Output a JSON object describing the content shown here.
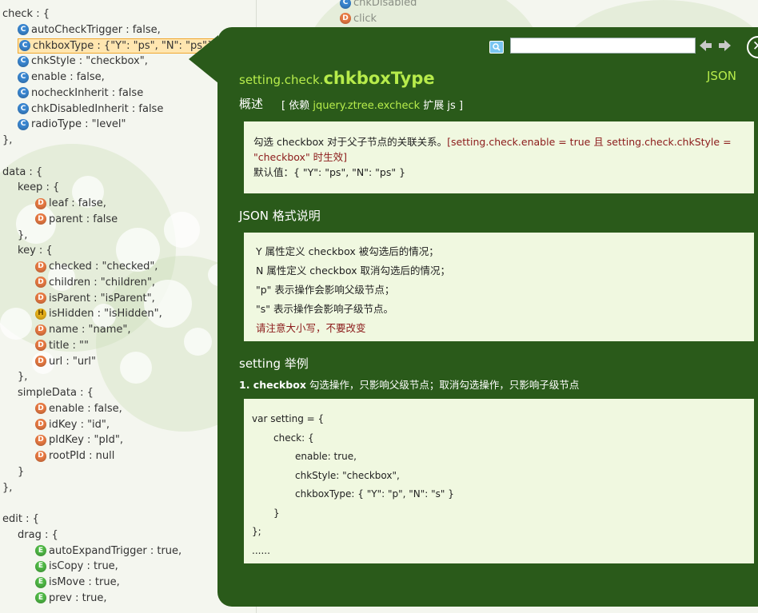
{
  "tree": {
    "lines": [
      {
        "id": "check-open",
        "indent": 0,
        "icon": "",
        "text": "check : {"
      },
      {
        "id": "check-autoCheckTrigger",
        "indent": 1,
        "icon": "c",
        "text": "autoCheckTrigger : false,"
      },
      {
        "id": "check-chkboxType",
        "indent": 1,
        "icon": "c",
        "text": "chkboxType : {\"Y\": \"ps\", \"N\": \"ps\"},",
        "current": true
      },
      {
        "id": "check-chkStyle",
        "indent": 1,
        "icon": "c",
        "text": "chkStyle : \"checkbox\","
      },
      {
        "id": "check-enable",
        "indent": 1,
        "icon": "c",
        "text": "enable : false,"
      },
      {
        "id": "check-nocheckInherit",
        "indent": 1,
        "icon": "c",
        "text": "nocheckInherit : false"
      },
      {
        "id": "check-chkDisabledInherit",
        "indent": 1,
        "icon": "c",
        "text": "chkDisabledInherit : false"
      },
      {
        "id": "check-radioType",
        "indent": 1,
        "icon": "c",
        "text": "radioType : \"level\""
      },
      {
        "id": "check-close",
        "indent": 0,
        "icon": "",
        "text": "},"
      },
      {
        "id": "blank1",
        "indent": 0,
        "icon": "",
        "text": ""
      },
      {
        "id": "data-open",
        "indent": 0,
        "icon": "",
        "text": "data : {"
      },
      {
        "id": "keep-open",
        "indent": 1,
        "icon": "",
        "text": "keep : {"
      },
      {
        "id": "keep-leaf",
        "indent": 2,
        "icon": "d",
        "text": "leaf : false,"
      },
      {
        "id": "keep-parent",
        "indent": 2,
        "icon": "d",
        "text": "parent : false"
      },
      {
        "id": "keep-close",
        "indent": 1,
        "icon": "",
        "text": "},"
      },
      {
        "id": "key-open",
        "indent": 1,
        "icon": "",
        "text": "key : {"
      },
      {
        "id": "key-checked",
        "indent": 2,
        "icon": "d",
        "text": "checked : \"checked\","
      },
      {
        "id": "key-children",
        "indent": 2,
        "icon": "d",
        "text": "children : \"children\","
      },
      {
        "id": "key-isParent",
        "indent": 2,
        "icon": "d",
        "text": "isParent : \"isParent\","
      },
      {
        "id": "key-isHidden",
        "indent": 2,
        "icon": "h",
        "text": "isHidden : \"isHidden\","
      },
      {
        "id": "key-name",
        "indent": 2,
        "icon": "d",
        "text": "name : \"name\","
      },
      {
        "id": "key-title",
        "indent": 2,
        "icon": "d",
        "text": "title : \"\""
      },
      {
        "id": "key-url",
        "indent": 2,
        "icon": "d",
        "text": "url : \"url\""
      },
      {
        "id": "key-close",
        "indent": 1,
        "icon": "",
        "text": "},"
      },
      {
        "id": "simpleData-open",
        "indent": 1,
        "icon": "",
        "text": "simpleData : {"
      },
      {
        "id": "sd-enable",
        "indent": 2,
        "icon": "d",
        "text": "enable : false,"
      },
      {
        "id": "sd-idKey",
        "indent": 2,
        "icon": "d",
        "text": "idKey : \"id\","
      },
      {
        "id": "sd-pIdKey",
        "indent": 2,
        "icon": "d",
        "text": "pIdKey : \"pId\","
      },
      {
        "id": "sd-rootPId",
        "indent": 2,
        "icon": "d",
        "text": "rootPId : null"
      },
      {
        "id": "simpleData-close",
        "indent": 1,
        "icon": "",
        "text": "}"
      },
      {
        "id": "data-close",
        "indent": 0,
        "icon": "",
        "text": "},"
      },
      {
        "id": "blank2",
        "indent": 0,
        "icon": "",
        "text": ""
      },
      {
        "id": "edit-open",
        "indent": 0,
        "icon": "",
        "text": "edit : {"
      },
      {
        "id": "drag-open",
        "indent": 1,
        "icon": "",
        "text": "drag : {"
      },
      {
        "id": "drag-autoExpandTrigger",
        "indent": 2,
        "icon": "e",
        "text": "autoExpandTrigger : true,"
      },
      {
        "id": "drag-isCopy",
        "indent": 2,
        "icon": "e",
        "text": "isCopy : true,"
      },
      {
        "id": "drag-isMove",
        "indent": 2,
        "icon": "e",
        "text": "isMove : true,"
      },
      {
        "id": "drag-prev",
        "indent": 2,
        "icon": "e",
        "text": "prev : true,"
      }
    ],
    "icon_letters": {
      "c": "C",
      "d": "D",
      "h": "H",
      "e": "E"
    }
  },
  "right_column": [
    {
      "id": "rc-chkDisabled",
      "icon": "c",
      "text": "chkDisabled"
    },
    {
      "id": "rc-click",
      "icon": "d",
      "text": "click"
    }
  ],
  "panel": {
    "search_placeholder": "",
    "title_prefix": "setting.check.",
    "title_main": "chkboxType",
    "json_link": "JSON",
    "overview_label": "概述",
    "dep_prefix": "[ 依赖 ",
    "dep_link": "jquery.ztree.excheck",
    "dep_suffix": " 扩展 js ]",
    "desc_text": "勾选 checkbox 对于父子节点的关联关系。",
    "desc_note": "[setting.check.enable = true 且 setting.check.chkStyle = \"checkbox\" 时生效]",
    "default_value": "默认值：{ \"Y\": \"ps\", \"N\": \"ps\" }",
    "json_section_title": "JSON 格式说明",
    "json_lines": [
      "Y 属性定义 checkbox 被勾选后的情况；",
      "N 属性定义 checkbox 取消勾选后的情况；",
      "\"p\" 表示操作会影响父级节点；",
      "\"s\" 表示操作会影响子级节点。"
    ],
    "json_note": "请注意大小写，不要改变",
    "example_section_title": "setting 举例",
    "example_title_num": "1. checkbox",
    "example_title_text": " 勾选操作，只影响父级节点；取消勾选操作，只影响子级节点",
    "code": "var setting = {\n\tcheck: {\n\t\tenable: true,\n\t\tchkStyle: \"checkbox\",\n\t\tchkboxType: { \"Y\": \"p\", \"N\": \"s\" }\n\t}\n};\n......"
  },
  "colors": {
    "panel_bg": "#2a5a1a",
    "accent_green": "#b7ec4b",
    "box_bg": "#f0f8e0",
    "note_red": "#8b1a1a",
    "current_highlight": "#ffe6b0"
  }
}
